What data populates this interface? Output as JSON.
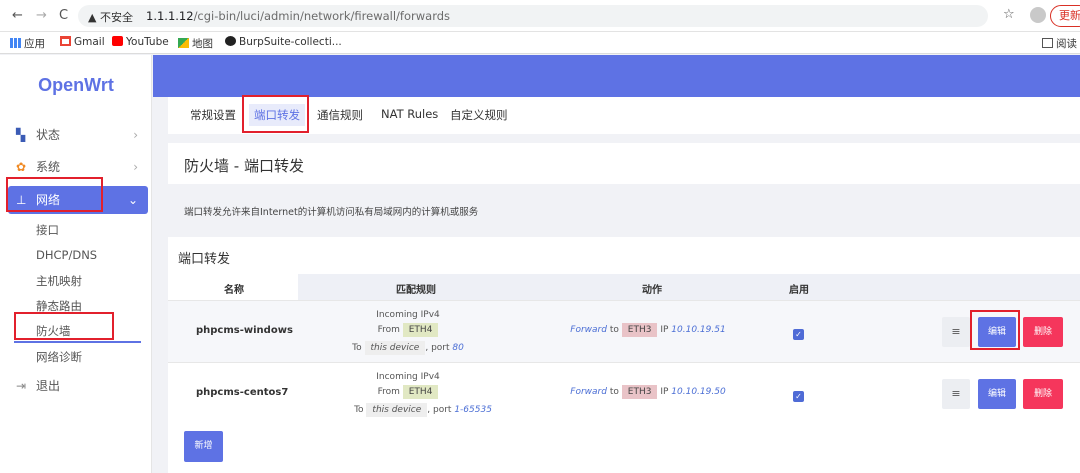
{
  "browser": {
    "back": "←",
    "forward": "→",
    "reload": "C",
    "security": "▲ 不安全",
    "url_host": "1.1.1.12",
    "url_path": "/cgi-bin/luci/admin/network/firewall/forwards",
    "update": "更新"
  },
  "bookmarks": [
    {
      "label": "应用",
      "icon": "apps-icon"
    },
    {
      "label": "Gmail",
      "icon": "gmail-icon"
    },
    {
      "label": "YouTube",
      "icon": "youtube-icon"
    },
    {
      "label": "地图",
      "icon": "maps-icon"
    },
    {
      "label": "BurpSuite-collecti...",
      "icon": "github-icon"
    }
  ],
  "reading_list": "阅读",
  "sidebar": {
    "logo": "OpenWrt",
    "items": [
      {
        "label": "状态",
        "icon": "status-icon"
      },
      {
        "label": "系统",
        "icon": "gear-icon"
      },
      {
        "label": "网络",
        "icon": "network-icon"
      },
      {
        "label": "退出",
        "icon": "logout-icon"
      }
    ],
    "subitems": [
      "接口",
      "DHCP/DNS",
      "主机映射",
      "静态路由",
      "防火墙",
      "网络诊断"
    ]
  },
  "tabs": [
    "常规设置",
    "端口转发",
    "通信规则",
    "NAT Rules",
    "自定义规则"
  ],
  "page": {
    "title": "防火墙 - 端口转发",
    "description": "端口转发允许来自Internet的计算机访问私有局域网内的计算机或服务",
    "section_title": "端口转发"
  },
  "table": {
    "headers": [
      "名称",
      "匹配规则",
      "动作",
      "启用"
    ],
    "rows": [
      {
        "name": "phpcms-windows",
        "proto": "Incoming IPv4",
        "from_label": "From",
        "from_zone": "ETH4",
        "to_label": "To",
        "to_dev": "this device",
        "port_label": ", port",
        "port": "80",
        "forward": "Forward",
        "to_word": "to",
        "dest_zone": "ETH3",
        "ip_label": "IP",
        "ip": "10.10.19.51",
        "enabled": true
      },
      {
        "name": "phpcms-centos7",
        "proto": "Incoming IPv4",
        "from_label": "From",
        "from_zone": "ETH4",
        "to_label": "To",
        "to_dev": "this device",
        "port_label": ", port",
        "port": "1-65535",
        "forward": "Forward",
        "to_word": "to",
        "dest_zone": "ETH3",
        "ip_label": "IP",
        "ip": "10.10.19.50",
        "enabled": true
      }
    ],
    "menu_label": "≡",
    "edit_label": "编辑",
    "delete_label": "删除"
  },
  "add_label": "新增"
}
